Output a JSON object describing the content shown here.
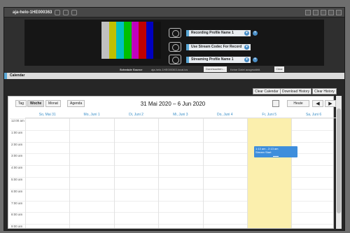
{
  "window": {
    "title": "aja-helo-1HE000363"
  },
  "preview": {
    "bar_colors": [
      "#c0c0c0",
      "#c0c000",
      "#00c0c0",
      "#00c000",
      "#c000c0",
      "#c00000",
      "#0000c0",
      "#111111"
    ],
    "rows": [
      {
        "label": "Recording Profile Name 1",
        "icon": "record-icon"
      },
      {
        "label": "Use Stream Codec For Record",
        "icon": "link-icon"
      },
      {
        "label": "Streaming Profile Name 1",
        "icon": "stream-icon"
      }
    ]
  },
  "schedule": {
    "source_label": "Schedule Source",
    "file": "aja-helo-1HE000363-local.ics",
    "browse": "Durchsuchen...",
    "no_file": "Keine Datei ausgewählt.",
    "clear": "Clear"
  },
  "calendar": {
    "header": "Calendar",
    "buttons": {
      "clear": "Clear Calendar",
      "download": "Download History",
      "clear_history": "Clear History"
    },
    "views": {
      "day": "Tag",
      "week": "Woche",
      "month": "Monat",
      "agenda": "Agenda"
    },
    "range_title": "31 Mai 2020 – 6 Jun 2020",
    "today": "Heute",
    "prev": "◀",
    "next": "▶",
    "days": [
      "So, Mai 31",
      "Mo, Juni 1",
      "Di, Juni 2",
      "Mi, Juni 3",
      "Do, Juni 4",
      "Fr, Juni 5",
      "Sa, Juni 6"
    ],
    "hours": [
      "12:00 am",
      "1:00 am",
      "2:00 am",
      "3:00 am",
      "4:00 am",
      "5:00 am",
      "6:00 am",
      "7:00 am",
      "8:00 am",
      "9:00 am"
    ],
    "event": {
      "time": "1:13 am - 2:13 am",
      "title": "Stream Start"
    }
  }
}
